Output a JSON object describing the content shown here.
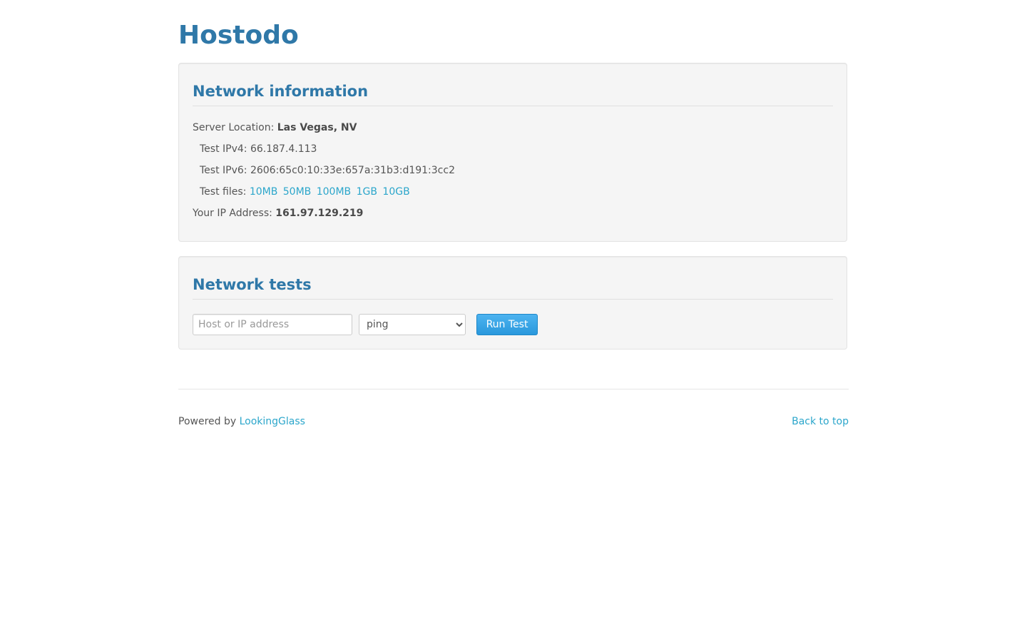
{
  "header": {
    "title": "Hostodo"
  },
  "network_info": {
    "title": "Network information",
    "server_location_label": "Server Location:",
    "server_location_value": "Las Vegas, NV",
    "ipv4_label": "Test IPv4:",
    "ipv4_value": "66.187.4.113",
    "ipv6_label": "Test IPv6:",
    "ipv6_value": "2606:65c0:10:33e:657a:31b3:d191:3cc2",
    "files_label": "Test files:",
    "files": [
      "10MB",
      "50MB",
      "100MB",
      "1GB",
      "10GB"
    ],
    "your_ip_label": "Your IP Address:",
    "your_ip_value": "161.97.129.219"
  },
  "network_tests": {
    "title": "Network tests",
    "host_placeholder": "Host or IP address",
    "selected_test": "ping",
    "run_label": "Run Test"
  },
  "footer": {
    "powered_by": "Powered by",
    "powered_link": "LookingGlass",
    "back_to_top": "Back to top"
  },
  "colors": {
    "brand": "#2f78a8",
    "link": "#2ba6cb",
    "button": "#2a98dc"
  }
}
